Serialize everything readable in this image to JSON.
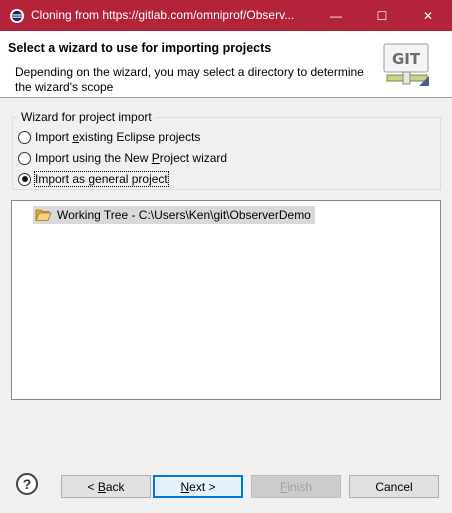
{
  "window": {
    "title": "Cloning from https://gitlab.com/omniprof/Observ...",
    "minimize_glyph": "—",
    "maximize_glyph": "☐",
    "close_glyph": "✕"
  },
  "header": {
    "title": "Select a wizard to use for importing projects",
    "description": "Depending on the wizard, you may select a directory to determine the wizard's scope",
    "logo_text": "GIT"
  },
  "group": {
    "legend": "Wizard for project import",
    "options": [
      {
        "prefix": "Import ",
        "mnemonic": "e",
        "suffix": "xisting Eclipse projects",
        "checked": false
      },
      {
        "prefix": "Import using the New ",
        "mnemonic": "P",
        "suffix": "roject wizard",
        "checked": false
      },
      {
        "prefix": "Import as ",
        "mnemonic": "g",
        "suffix": "eneral project",
        "checked": true
      }
    ]
  },
  "tree": {
    "items": [
      {
        "label": "Working Tree - C:\\Users\\Ken\\git\\ObserverDemo",
        "icon": "folder-open-icon",
        "selected": true
      }
    ]
  },
  "footer": {
    "help_glyph": "?",
    "back": {
      "pre": "< ",
      "mnemonic": "B",
      "post": "ack"
    },
    "next": {
      "pre": "",
      "mnemonic": "N",
      "post": "ext >"
    },
    "finish": {
      "pre": "",
      "mnemonic": "F",
      "post": "inish"
    },
    "cancel": {
      "label": "Cancel"
    }
  },
  "colors": {
    "titlebar": "#b3233a",
    "dialog_bg": "#f0f0f0",
    "default_button_border": "#0078d7"
  }
}
